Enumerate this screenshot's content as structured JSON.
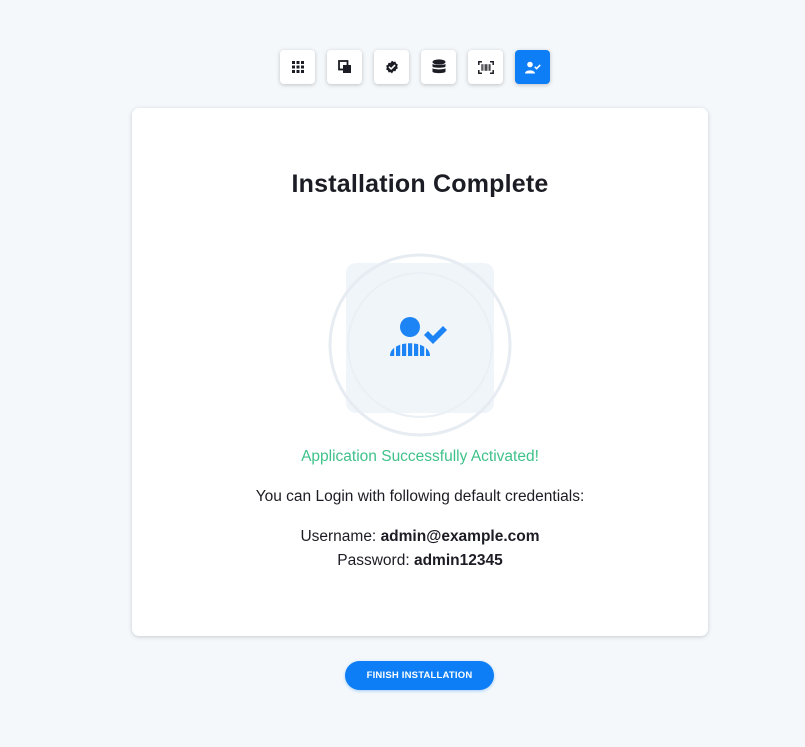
{
  "steps": [
    {
      "icon": "grid-icon",
      "active": false
    },
    {
      "icon": "copy-icon",
      "active": false
    },
    {
      "icon": "verified-badge-icon",
      "active": false
    },
    {
      "icon": "database-icon",
      "active": false
    },
    {
      "icon": "barcode-scan-icon",
      "active": false
    },
    {
      "icon": "user-check-icon",
      "active": true
    }
  ],
  "card": {
    "title": "Installation Complete",
    "illustration_icon": "user-check-icon",
    "success_message": "Application Successfully Activated!",
    "credentials_intro": "You can Login with following default credentials:",
    "username_label": "Username:",
    "username_value": "admin@example.com",
    "password_label": "Password:",
    "password_value": "admin12345"
  },
  "finish_button_label": "FINISH INSTALLATION",
  "colors": {
    "accent": "#0d7ef6",
    "success": "#3fc28a",
    "background": "#f4f8fb"
  }
}
